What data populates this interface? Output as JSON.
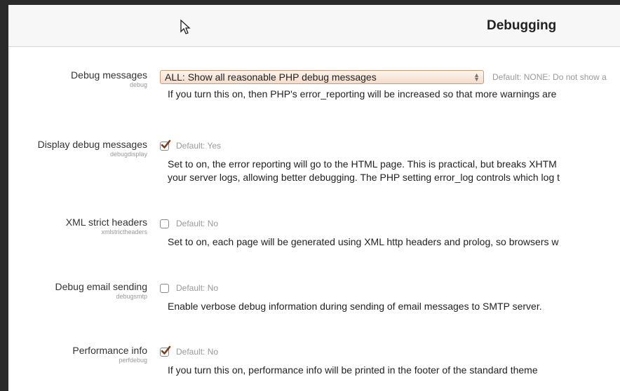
{
  "header": {
    "title": "Debugging"
  },
  "settings": [
    {
      "label": "Debug messages",
      "key": "debug",
      "control": "select",
      "value": "ALL: Show all reasonable PHP debug messages",
      "default": "Default: NONE: Do not show a",
      "description": [
        "If you turn this on, then PHP's error_reporting will be increased so that more warnings are"
      ]
    },
    {
      "label": "Display debug messages",
      "key": "debugdisplay",
      "control": "checkbox",
      "checked": true,
      "default": "Default: Yes",
      "description": [
        "Set to on, the error reporting will go to the HTML page. This is practical, but breaks XHTM",
        "your server logs, allowing better debugging. The PHP setting error_log controls which log t"
      ]
    },
    {
      "label": "XML strict headers",
      "key": "xmlstrictheaders",
      "control": "checkbox",
      "checked": false,
      "default": "Default: No",
      "description": [
        "Set to on, each page will be generated using XML http headers and prolog, so browsers w"
      ]
    },
    {
      "label": "Debug email sending",
      "key": "debugsmtp",
      "control": "checkbox",
      "checked": false,
      "default": "Default: No",
      "description": [
        "Enable verbose debug information during sending of email messages to SMTP server."
      ]
    },
    {
      "label": "Performance info",
      "key": "perfdebug",
      "control": "checkbox",
      "checked": true,
      "default": "Default: No",
      "description": [
        "If you turn this on, performance info will be printed in the footer of the standard theme"
      ]
    }
  ]
}
